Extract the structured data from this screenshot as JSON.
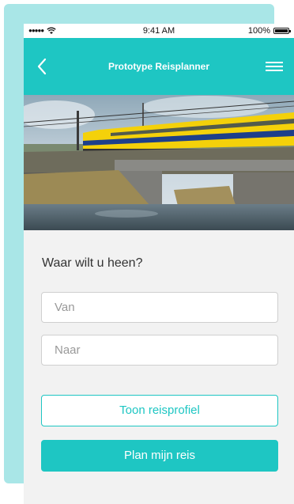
{
  "status_bar": {
    "signal": "●●●●●",
    "time": "9:41 AM",
    "battery": "100%"
  },
  "navbar": {
    "title": "Prototype Reisplanner",
    "back_icon": "chevron-left-icon",
    "menu_icon": "hamburger-menu-icon"
  },
  "form": {
    "question": "Waar wilt u heen?",
    "from_placeholder": "Van",
    "to_placeholder": "Naar",
    "profile_button": "Toon reisprofiel",
    "plan_button": "Plan mijn reis"
  },
  "colors": {
    "accent": "#1ec6c3",
    "backdrop": "#a9e6e7",
    "content_bg": "#f2f2f2"
  }
}
